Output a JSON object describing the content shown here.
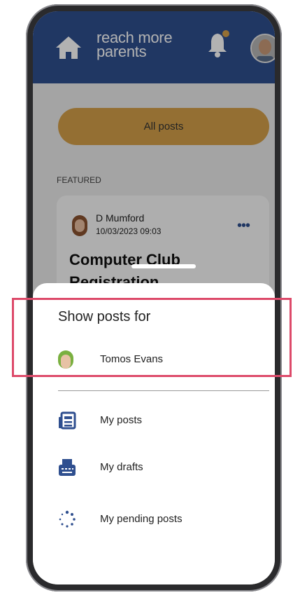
{
  "header": {
    "logo_line1": "reach more",
    "logo_line2": "parents"
  },
  "filter": {
    "all_posts_label": "All posts"
  },
  "feed": {
    "section_label": "FEATURED",
    "post": {
      "author": "D Mumford",
      "timestamp": "10/03/2023 09:03",
      "title": "Computer Club Registration",
      "more_label": "•••"
    }
  },
  "sheet": {
    "title": "Show posts for",
    "child_name": "Tomos Evans",
    "items": [
      {
        "label": "My posts",
        "icon": "newspaper-icon"
      },
      {
        "label": "My drafts",
        "icon": "drafts-icon"
      },
      {
        "label": "My pending posts",
        "icon": "pending-icon"
      }
    ]
  },
  "colors": {
    "brand": "#2f4f8f",
    "accent": "#d5a04a",
    "highlight": "#dd4a6a"
  }
}
